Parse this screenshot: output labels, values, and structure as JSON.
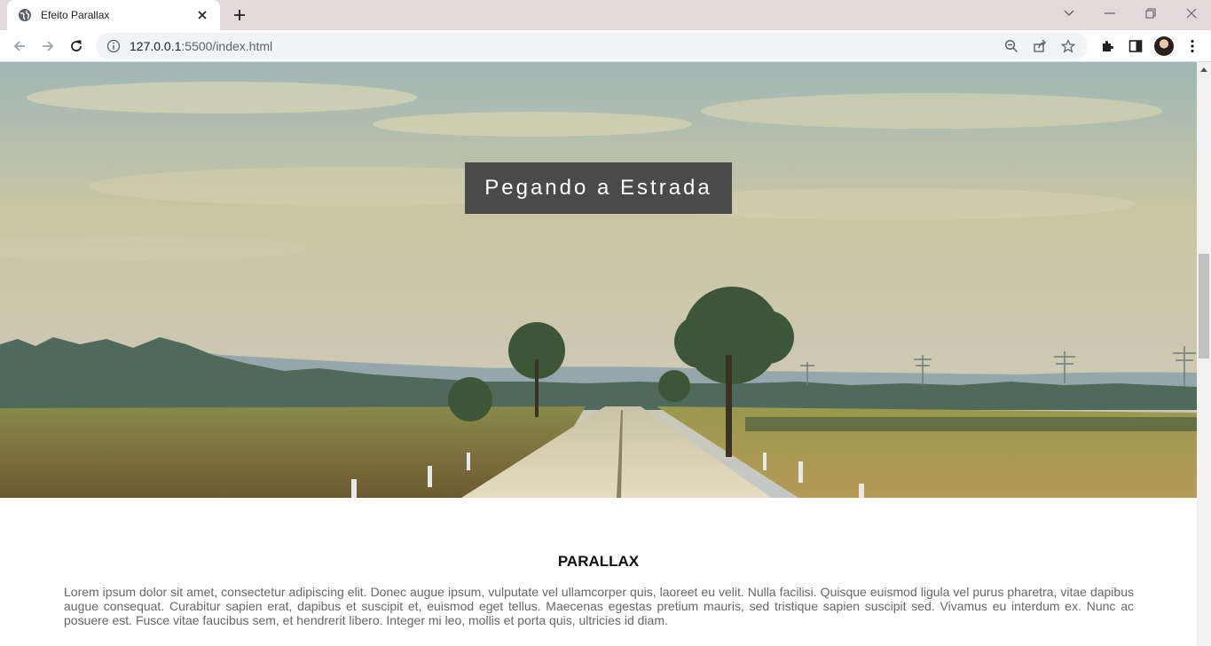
{
  "browser": {
    "tab_title": "Efeito Parallax",
    "url_host": "127.0.0.1",
    "url_path": ":5500/index.html"
  },
  "hero": {
    "title": "Pegando a Estrada"
  },
  "section": {
    "heading": "PARALLAX",
    "text": "Lorem ipsum dolor sit amet, consectetur adipiscing elit. Donec augue ipsum, vulputate vel ullamcorper quis, laoreet eu velit. Nulla facilisi. Quisque euismod ligula vel purus pharetra, vitae dapibus augue consequat. Curabitur sapien erat, dapibus et suscipit et, euismod eget tellus. Maecenas egestas pretium mauris, sed tristique sapien suscipit sed. Vivamus eu interdum ex. Nunc ac posuere est. Fusce vitae faucibus sem, et hendrerit libero. Integer mi leo, mollis et porta quis, ultricies id diam."
  },
  "colors": {
    "tabbar": "#e4d9da",
    "hero_title_bg": "#4a4a4a"
  }
}
